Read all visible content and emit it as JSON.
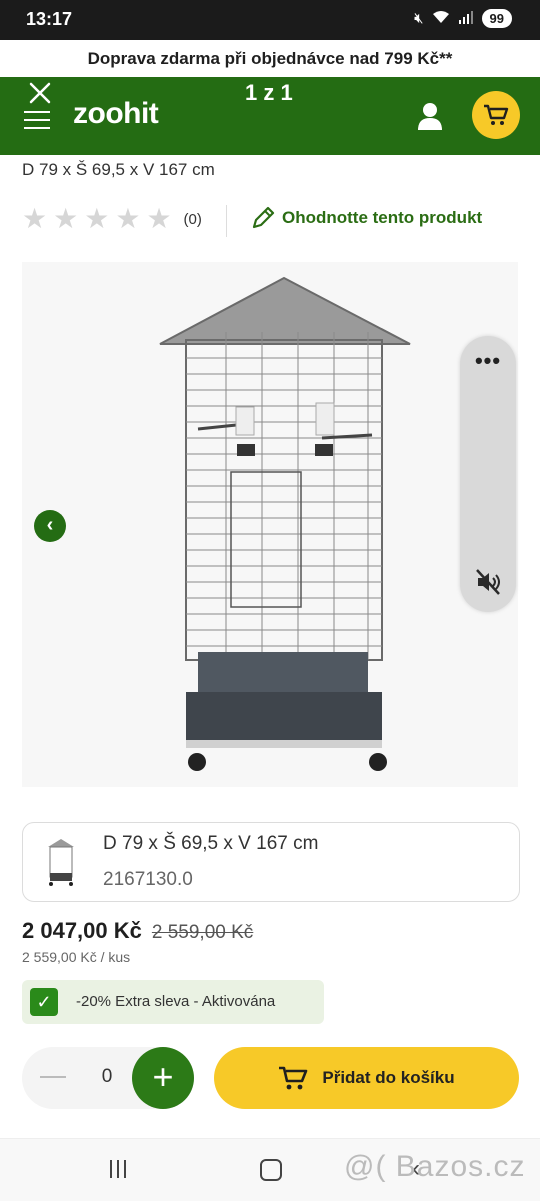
{
  "status": {
    "time": "13:17",
    "battery": "99"
  },
  "promo": {
    "text": "Doprava zdarma při objednávce nad 799 Kč**"
  },
  "header": {
    "logo": "zoohit",
    "counter": "1 z 1"
  },
  "product": {
    "dimensions": "D 79 x Š 69,5 x V 167 cm",
    "rating_count": "(0)",
    "rate_link": "Ohodnotte tento produkt",
    "stars_filled": 0,
    "stars_total": 5
  },
  "variant": {
    "name": "D 79 x Š 69,5 x V 167 cm",
    "code": "2167130.0"
  },
  "price": {
    "current": "2 047,00 Kč",
    "old": "2 559,00 Kč",
    "unit": "2 559,00 Kč / kus"
  },
  "discount": {
    "label": "-20% Extra sleva - Aktivována",
    "checked": true
  },
  "quantity": {
    "value": "0"
  },
  "cart_button": {
    "label": "Přidat do košíku"
  },
  "video": {
    "more_label": "•••"
  },
  "watermark": {
    "text": "@( Bazos.cz"
  },
  "colors": {
    "brand_green": "#246c13",
    "accent_yellow": "#f7c928"
  }
}
